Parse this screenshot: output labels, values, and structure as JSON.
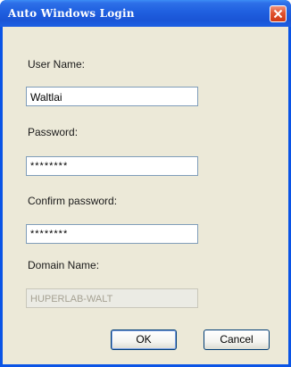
{
  "window": {
    "title": "Auto Windows Login",
    "close_icon": "close-icon",
    "accent_color": "#0a54e6"
  },
  "form": {
    "user_name": {
      "label": "User Name:",
      "value": "Waltlai"
    },
    "password": {
      "label": "Password:",
      "value": "********"
    },
    "confirm_password": {
      "label": "Confirm password:",
      "value": "********"
    },
    "domain_name": {
      "label": "Domain Name:",
      "value": "HUPERLAB-WALT",
      "disabled": true
    }
  },
  "buttons": {
    "ok_label": "OK",
    "cancel_label": "Cancel"
  }
}
